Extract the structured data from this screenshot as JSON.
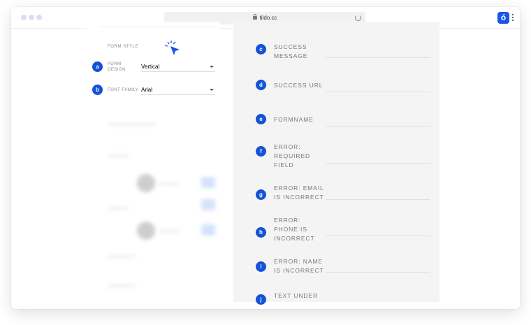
{
  "browser": {
    "url": "tildo.cc"
  },
  "settings": {
    "section_title": "FORM STYLE",
    "fields": [
      {
        "badge": "a",
        "label": "FORM DESIGN",
        "value": "Vertical"
      },
      {
        "badge": "b",
        "label": "FONT FAMILY",
        "value": "Arial"
      }
    ]
  },
  "form_preview": {
    "fields": [
      {
        "badge": "c",
        "label": "SUCCESS MESSAGE"
      },
      {
        "badge": "d",
        "label": "SUCCESS URL"
      },
      {
        "badge": "e",
        "label": "FORMNAME"
      },
      {
        "badge": "f",
        "label": "ERROR: REQUIRED FIELD"
      },
      {
        "badge": "g",
        "label": "ERROR: EMAIL IS INCORRECT"
      },
      {
        "badge": "h",
        "label": "ERROR: PHONE IS INCORRECT"
      },
      {
        "badge": "i",
        "label": "ERROR: NAME IS INCORRECT"
      },
      {
        "badge": "j",
        "label": "TEXT UNDER FORM"
      }
    ]
  },
  "colors": {
    "accent": "#1452d6",
    "app_icon": "#1a57e8"
  },
  "icons": {
    "lock": "lock-icon",
    "reload": "reload-icon",
    "app": "app-icon",
    "menu": "kebab-icon",
    "cursor": "cursor-icon",
    "dropdown": "caret-icon"
  }
}
